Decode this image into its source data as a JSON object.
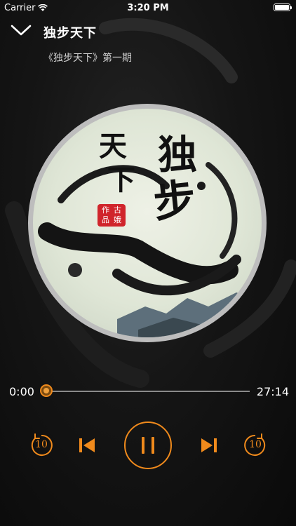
{
  "status": {
    "carrier": "Carrier",
    "time": "3:20 PM",
    "battery_level": 1.0
  },
  "header": {
    "title": "独步天下",
    "subtitle": "《独步天下》第一期"
  },
  "cover": {
    "characters": [
      "独",
      "步",
      "天",
      "下"
    ],
    "seal": [
      "作",
      "古",
      "品",
      "娥"
    ]
  },
  "player": {
    "current_time": "0:00",
    "duration": "27:14",
    "progress": 0.0,
    "state": "playing",
    "skip_back_seconds": "10",
    "skip_forward_seconds": "10"
  },
  "colors": {
    "accent": "#f08a1c",
    "background": "#111111"
  }
}
